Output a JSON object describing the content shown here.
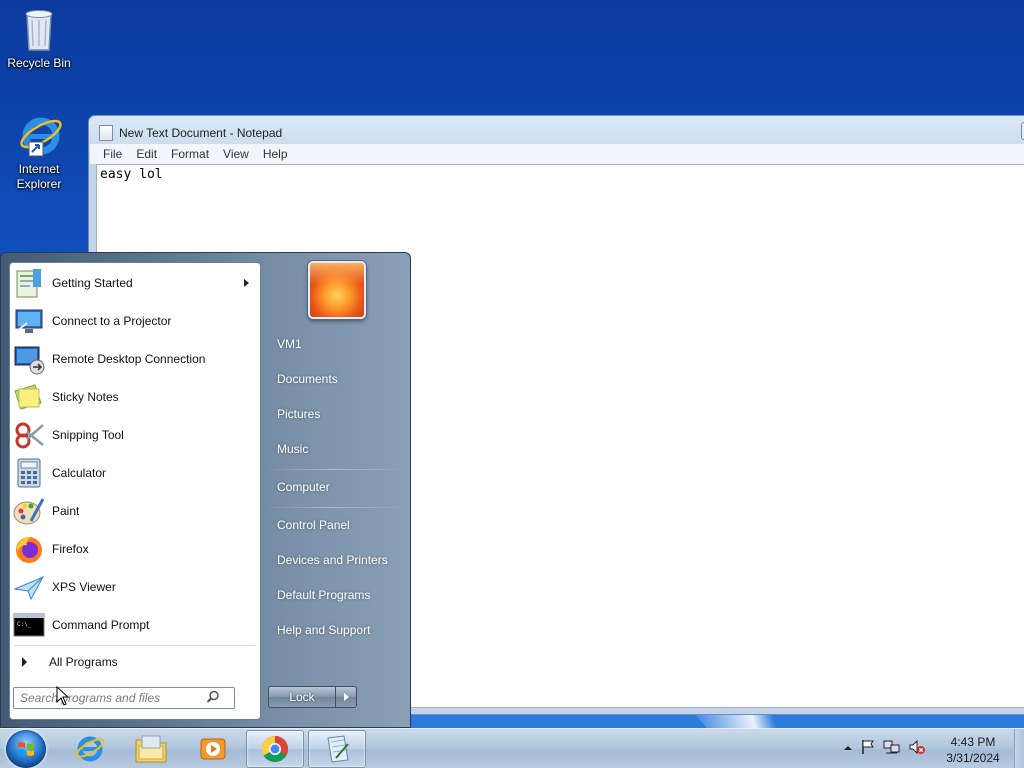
{
  "desktop": {
    "icons": [
      {
        "label": "Recycle Bin"
      },
      {
        "label": "Internet Explorer"
      }
    ]
  },
  "notepad": {
    "title": "New Text Document - Notepad",
    "menu": [
      "File",
      "Edit",
      "Format",
      "View",
      "Help"
    ],
    "content": "easy lol"
  },
  "start_menu": {
    "programs": [
      {
        "label": "Getting Started",
        "icon": "getting-started-icon",
        "has_submenu": true
      },
      {
        "label": "Connect to a Projector",
        "icon": "projector-icon"
      },
      {
        "label": "Remote Desktop Connection",
        "icon": "remote-desktop-icon"
      },
      {
        "label": "Sticky Notes",
        "icon": "sticky-notes-icon"
      },
      {
        "label": "Snipping Tool",
        "icon": "scissors-icon"
      },
      {
        "label": "Calculator",
        "icon": "calculator-icon"
      },
      {
        "label": "Paint",
        "icon": "paint-palette-icon"
      },
      {
        "label": "Firefox",
        "icon": "firefox-icon"
      },
      {
        "label": "XPS Viewer",
        "icon": "paper-plane-icon"
      },
      {
        "label": "Command Prompt",
        "icon": "terminal-icon"
      }
    ],
    "all_programs": "All Programs",
    "search_placeholder": "Search programs and files",
    "right_links": [
      "VM1",
      "Documents",
      "Pictures",
      "Music",
      "Computer",
      "Control Panel",
      "Devices and Printers",
      "Default Programs",
      "Help and Support"
    ],
    "lock_label": "Lock"
  },
  "taskbar": {
    "pinned": [
      "internet-explorer-icon",
      "file-explorer-icon",
      "media-player-icon",
      "chrome-icon",
      "notepad-icon"
    ],
    "clock_time": "4:43 PM",
    "clock_date": "3/31/2024"
  },
  "colors": {
    "desktop": "#1150bf",
    "start_menu": "#5f7791",
    "taskbar": "#b3c8de"
  }
}
